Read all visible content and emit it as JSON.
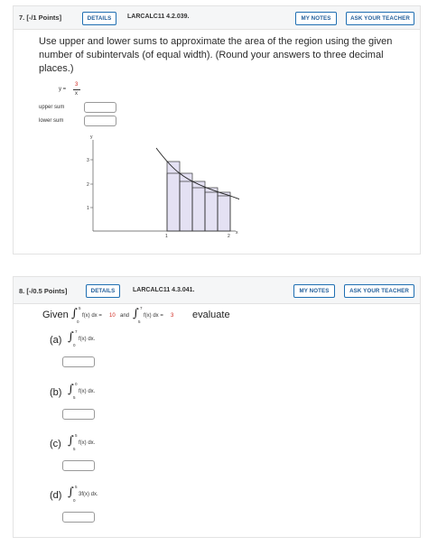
{
  "q7": {
    "number": "7. [-/1 Points]",
    "details_label": "DETAILS",
    "code": "LARCALC11 4.2.039.",
    "my_notes_label": "MY NOTES",
    "ask_label": "ASK YOUR TEACHER",
    "prompt": "Use upper and lower sums to approximate the area of the region using the given number of subintervals (of equal width). (Round your answers to three decimal places.)",
    "function": {
      "lhs": "y =",
      "numerator": "3",
      "denominator": "x"
    },
    "upper_label": "upper sum",
    "lower_label": "lower sum",
    "upper_value": "",
    "lower_value": "",
    "graph": {
      "y_label": "y",
      "x_label": "x",
      "y_ticks": [
        "1",
        "2",
        "3"
      ],
      "x_ticks": [
        "1",
        "2"
      ]
    }
  },
  "q8": {
    "number": "8. [-/0.5 Points]",
    "details_label": "DETAILS",
    "code": "LARCALC11 4.3.041.",
    "my_notes_label": "MY NOTES",
    "ask_label": "ASK YOUR TEACHER",
    "given_label": "Given",
    "given1": {
      "lower": "0",
      "upper": "5",
      "integrand": "f(x) dx =",
      "value": "10"
    },
    "and_label": "and",
    "given2": {
      "lower": "5",
      "upper": "7",
      "integrand": "f(x) dx =",
      "value": "3"
    },
    "evaluate_label": "evaluate",
    "parts": [
      {
        "label": "(a)",
        "lower": "0",
        "upper": "7",
        "integrand": "f(x) dx.",
        "value": ""
      },
      {
        "label": "(b)",
        "lower": "5",
        "upper": "0",
        "integrand": "f(x) dx.",
        "value": ""
      },
      {
        "label": "(c)",
        "lower": "5",
        "upper": "5",
        "integrand": "f(x) dx.",
        "value": ""
      },
      {
        "label": "(d)",
        "lower": "0",
        "upper": "5",
        "integrand": "3f(x) dx.",
        "value": ""
      }
    ]
  },
  "colors": {
    "accent": "#1f6fb2",
    "bar_fill": "#e4e1f3",
    "red": "#d0281f"
  }
}
